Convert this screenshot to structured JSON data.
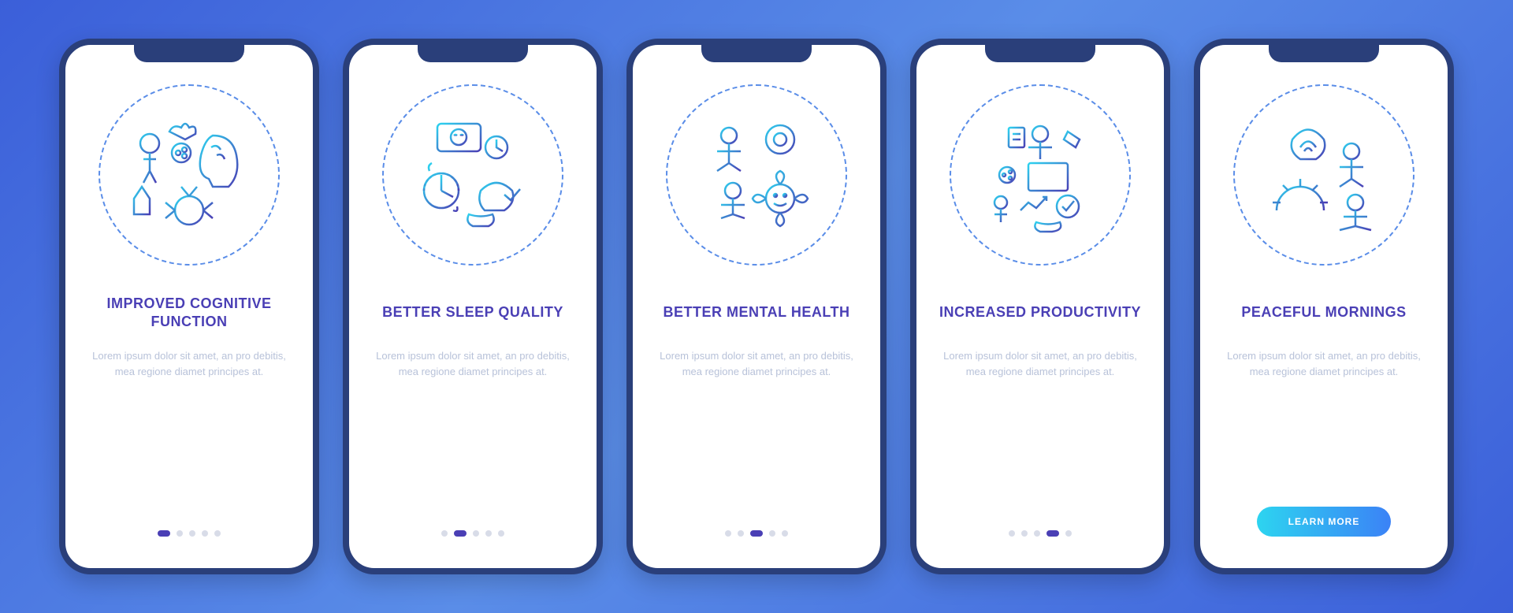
{
  "screens": [
    {
      "title": "IMPROVED COGNITIVE FUNCTION",
      "description": "Lorem ipsum dolor sit amet, an pro debitis, mea regione diamet principes at.",
      "activeIndex": 0,
      "showButton": false
    },
    {
      "title": "BETTER SLEEP QUALITY",
      "description": "Lorem ipsum dolor sit amet, an pro debitis, mea regione diamet principes at.",
      "activeIndex": 1,
      "showButton": false
    },
    {
      "title": "BETTER MENTAL HEALTH",
      "description": "Lorem ipsum dolor sit amet, an pro debitis, mea regione diamet principes at.",
      "activeIndex": 2,
      "showButton": false
    },
    {
      "title": "INCREASED PRODUCTIVITY",
      "description": "Lorem ipsum dolor sit amet, an pro debitis, mea regione diamet principes at.",
      "activeIndex": 3,
      "showButton": false
    },
    {
      "title": "PEACEFUL MORNINGS",
      "description": "Lorem ipsum dolor sit amet, an pro debitis, mea regione diamet principes at.",
      "activeIndex": 4,
      "showButton": true
    }
  ],
  "buttonLabel": "LEARN MORE",
  "totalDots": 5,
  "colors": {
    "accent": "#4a3fb5",
    "gradient1": "#2dd4f0",
    "gradient2": "#3b82f6"
  }
}
